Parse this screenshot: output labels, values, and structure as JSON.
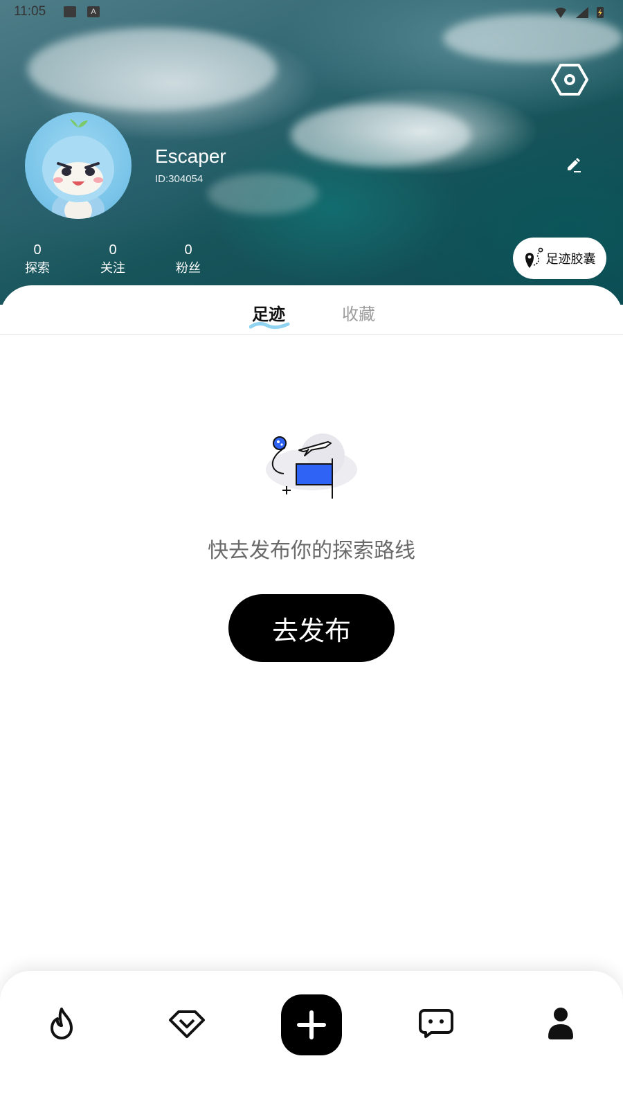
{
  "status_bar": {
    "time": "11:05",
    "icons": [
      "image-icon",
      "font-a-icon",
      "wifi-icon",
      "signal-icon",
      "battery-icon"
    ],
    "a_glyph": "A"
  },
  "header": {
    "settings_icon": "hexagon-settings-icon",
    "edit_icon": "pencil-icon"
  },
  "profile": {
    "name": "Escaper",
    "id_text": "ID:304054",
    "stats": [
      {
        "value": "0",
        "label": "探索"
      },
      {
        "value": "0",
        "label": "关注"
      },
      {
        "value": "0",
        "label": "粉丝"
      }
    ],
    "capsule_label": "足迹胶囊"
  },
  "tabs": [
    {
      "label": "足迹",
      "active": true
    },
    {
      "label": "收藏",
      "active": false
    }
  ],
  "empty_state": {
    "message": "快去发布你的探索路线",
    "button_label": "去发布"
  },
  "bottom_nav": {
    "items": [
      "fire-icon",
      "diamond-icon",
      "plus-icon",
      "chat-icon",
      "person-icon"
    ]
  },
  "colors": {
    "accent_blue": "#2f63f5",
    "primary_black": "#000000",
    "muted_text": "#6a6a6a",
    "inactive_tab": "#9b9b9b",
    "ocean_teal": "#17545a"
  }
}
